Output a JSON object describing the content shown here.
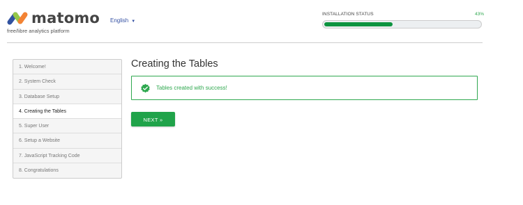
{
  "brand": {
    "name": "matomo",
    "tagline": "free/libre analytics platform"
  },
  "language": {
    "selected": "English",
    "caret": "▼"
  },
  "install_status": {
    "label": "INSTALLATION STATUS",
    "percent_text": "43%",
    "progress_fraction": 0.43
  },
  "steps": [
    "1. Welcome!",
    "2. System Check",
    "3. Database Setup",
    "4. Creating the Tables",
    "5. Super User",
    "6. Setup a Website",
    "7. JavaScript Tracking Code",
    "8. Congratulations"
  ],
  "active_step_index": 3,
  "main": {
    "title": "Creating the Tables",
    "success_message": "Tables created with success!",
    "next_label": "NEXT »"
  },
  "colors": {
    "accent": "#20a34a",
    "success": "#2fa84f",
    "link": "#3450a3"
  }
}
